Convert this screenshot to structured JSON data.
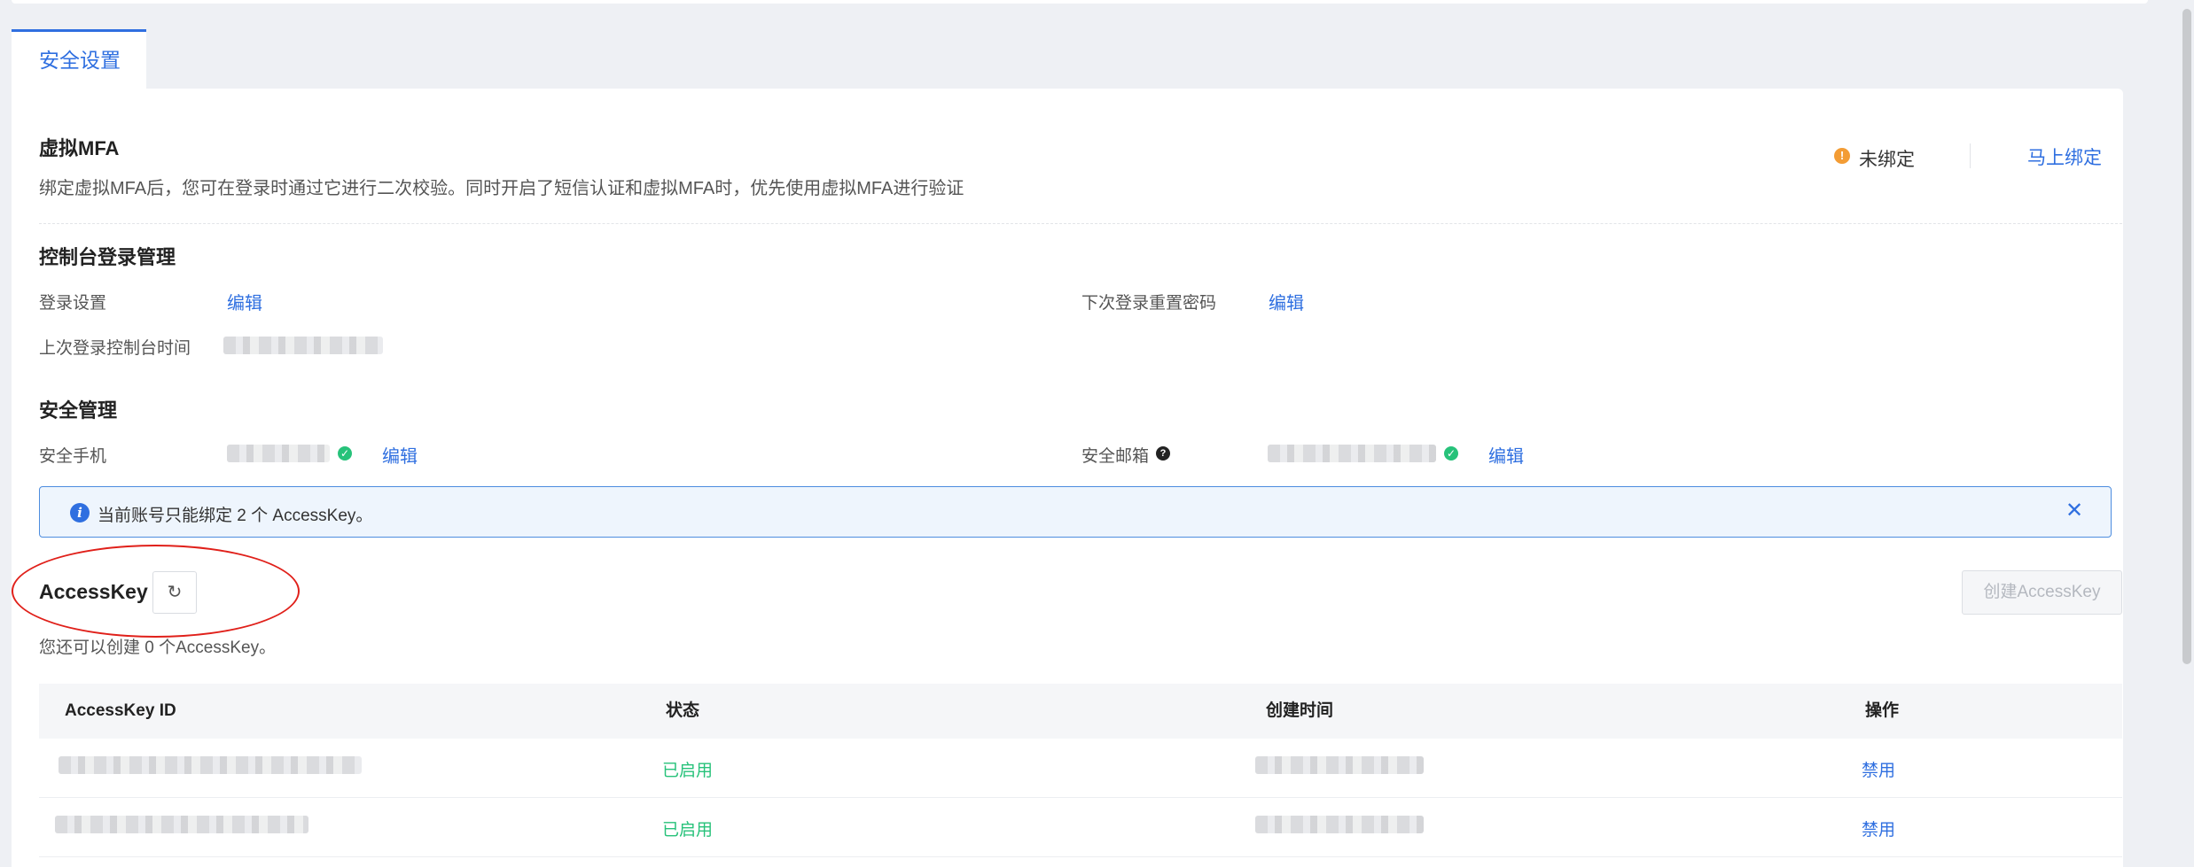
{
  "tabs": [
    {
      "label": "安全设置"
    }
  ],
  "mfa": {
    "title": "虚拟MFA",
    "description": "绑定虚拟MFA后，您可在登录时通过它进行二次校验。同时开启了短信认证和虚拟MFA时，优先使用虚拟MFA进行验证",
    "status_text": "未绑定",
    "bind_link": "马上绑定",
    "status_color": "#f39c34"
  },
  "console_login": {
    "title": "控制台登录管理",
    "login_settings_label": "登录设置",
    "login_settings_edit": "编辑",
    "reset_password_label": "下次登录重置密码",
    "reset_password_edit": "编辑",
    "last_login_label": "上次登录控制台时间"
  },
  "security": {
    "title": "安全管理",
    "phone_label": "安全手机",
    "phone_edit": "编辑",
    "email_label": "安全邮箱",
    "email_help_icon": "?",
    "email_edit": "编辑"
  },
  "notice": {
    "text": "当前账号只能绑定 2 个 AccessKey。",
    "info_icon": "i",
    "close_icon": "✕"
  },
  "accesskey": {
    "title": "AccessKey",
    "refresh_icon": "↻",
    "create_button": "创建AccessKey",
    "remaining_text": "您还可以创建 0 个AccessKey。",
    "columns": [
      "AccessKey ID",
      "状态",
      "创建时间",
      "操作"
    ],
    "rows": [
      {
        "status": "已启用",
        "action": "禁用"
      },
      {
        "status": "已启用",
        "action": "禁用"
      }
    ]
  },
  "colors": {
    "accent": "#2f6fe0",
    "enabled": "#27c27a",
    "highlight": "#e0201a"
  }
}
